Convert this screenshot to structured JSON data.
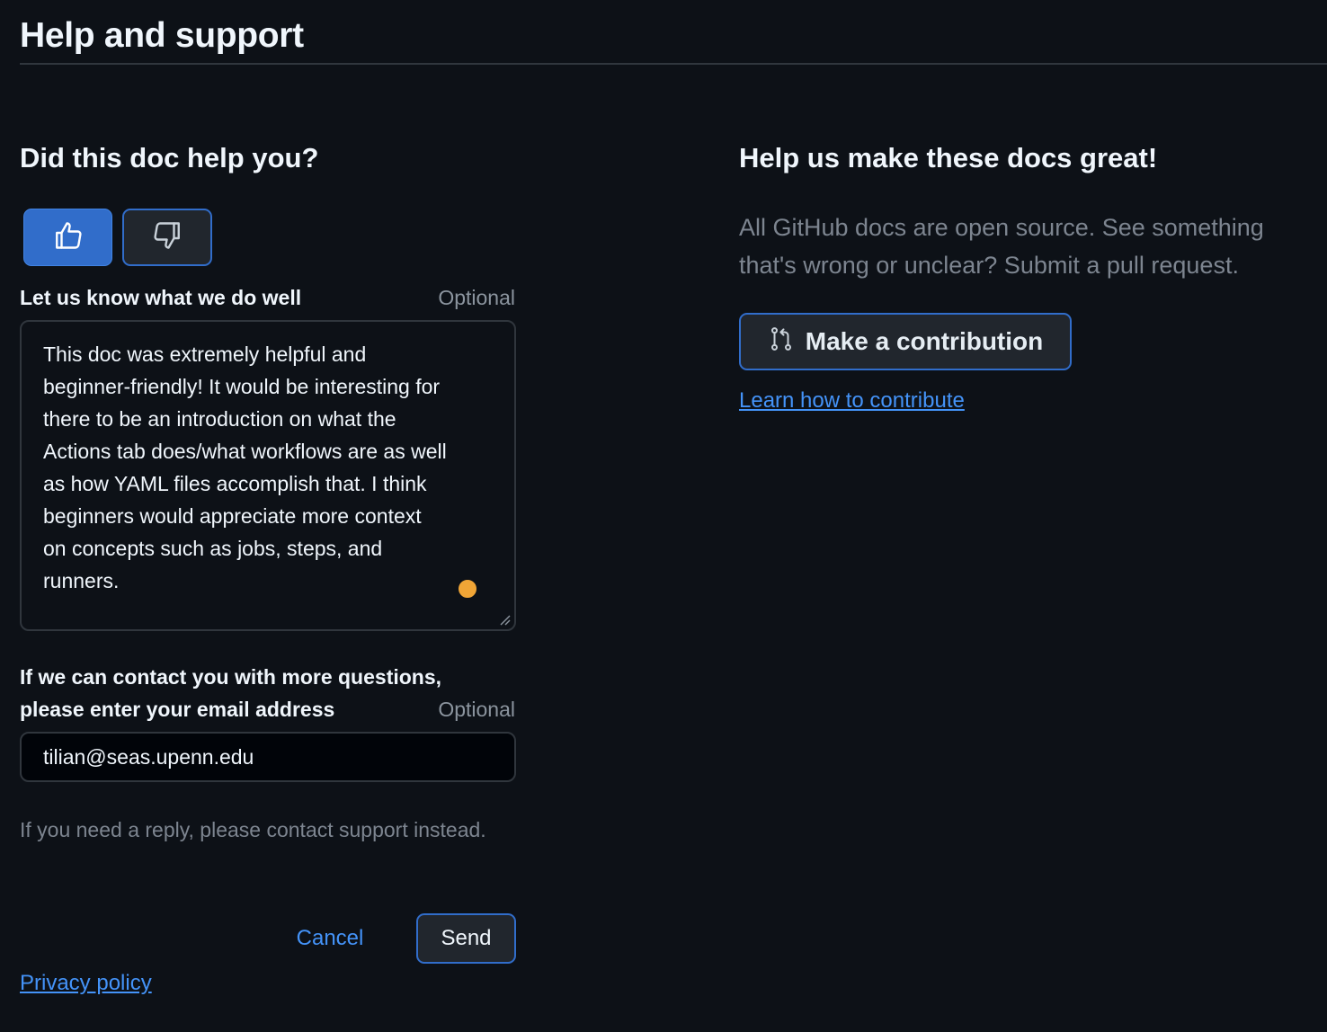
{
  "header": {
    "title": "Help and support"
  },
  "feedback": {
    "heading": "Did this doc help you?",
    "thumbs_up_icon": "thumbs-up-icon",
    "thumbs_down_icon": "thumbs-down-icon",
    "selected_vote": "yes",
    "comment_label": "Let us know what we do well",
    "comment_optional": "Optional",
    "comment_value": "This doc was extremely helpful and\nbeginner-friendly! It would be interesting for\nthere to be an introduction on what the\nActions tab does/what workflows are as well\nas how YAML files accomplish that. I think\nbeginners would appreciate more context\non concepts such as jobs, steps, and\nrunners.",
    "email_label_line1": "If we can contact you with more questions,",
    "email_label_line2": "please enter your email address",
    "email_optional": "Optional",
    "email_value": "tilian@seas.upenn.edu",
    "reply_note": "If you need a reply, please contact support instead.",
    "cancel_label": "Cancel",
    "send_label": "Send",
    "privacy_link": "Privacy policy"
  },
  "contribute": {
    "heading": "Help us make these docs great!",
    "description": "All GitHub docs are open source. See something that's wrong or unclear? Submit a pull request.",
    "button_icon": "git-pull-request-icon",
    "button_label": "Make a contribution",
    "learn_link": "Learn how to contribute"
  },
  "colors": {
    "background": "#0d1117",
    "accent": "#316dca",
    "link": "#4493f8",
    "muted": "#7d8590",
    "grammar_dot": "#f0a536"
  }
}
